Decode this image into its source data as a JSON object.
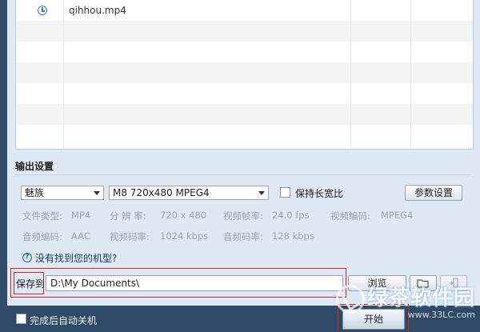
{
  "file_list": {
    "items": [
      {
        "icon": "clock-icon",
        "name": "qihhou.mp4"
      }
    ]
  },
  "output_settings": {
    "title": "输出设置",
    "brand_select": "魅族",
    "format_select": "M8 720x480 MPEG4",
    "keep_aspect_label": "保持长宽比",
    "param_button": "参数设置",
    "info": {
      "file_type_label": "文件类型:",
      "file_type_value": "MP4",
      "resolution_label": "分 辨 率:",
      "resolution_value": "720 x 480",
      "frame_rate_label": "视频帧率:",
      "frame_rate_value": "24.0 fps",
      "video_codec_label": "视频编码:",
      "video_codec_value": "MPEG4",
      "audio_codec_label": "音频编码:",
      "audio_codec_value": "AAC",
      "video_bitrate_label": "视频码率:",
      "video_bitrate_value": "1024 kbps",
      "audio_bitrate_label": "音频码率:",
      "audio_bitrate_value": "128 kbps"
    },
    "help_text": "没有找到您的机型?"
  },
  "save": {
    "label": "保存到:",
    "path": "D:\\My Documents\\",
    "browse_button": "浏览"
  },
  "bottom": {
    "auto_shutdown_label": "完成后自动关机",
    "start_button": "开始"
  },
  "watermark": {
    "main": "绿茶软件园",
    "url": "www.33LC.com"
  },
  "colors": {
    "accent_blue": "#3a78c2",
    "annotation_red": "#e02020",
    "bottom_bar": "#2e4a66"
  }
}
